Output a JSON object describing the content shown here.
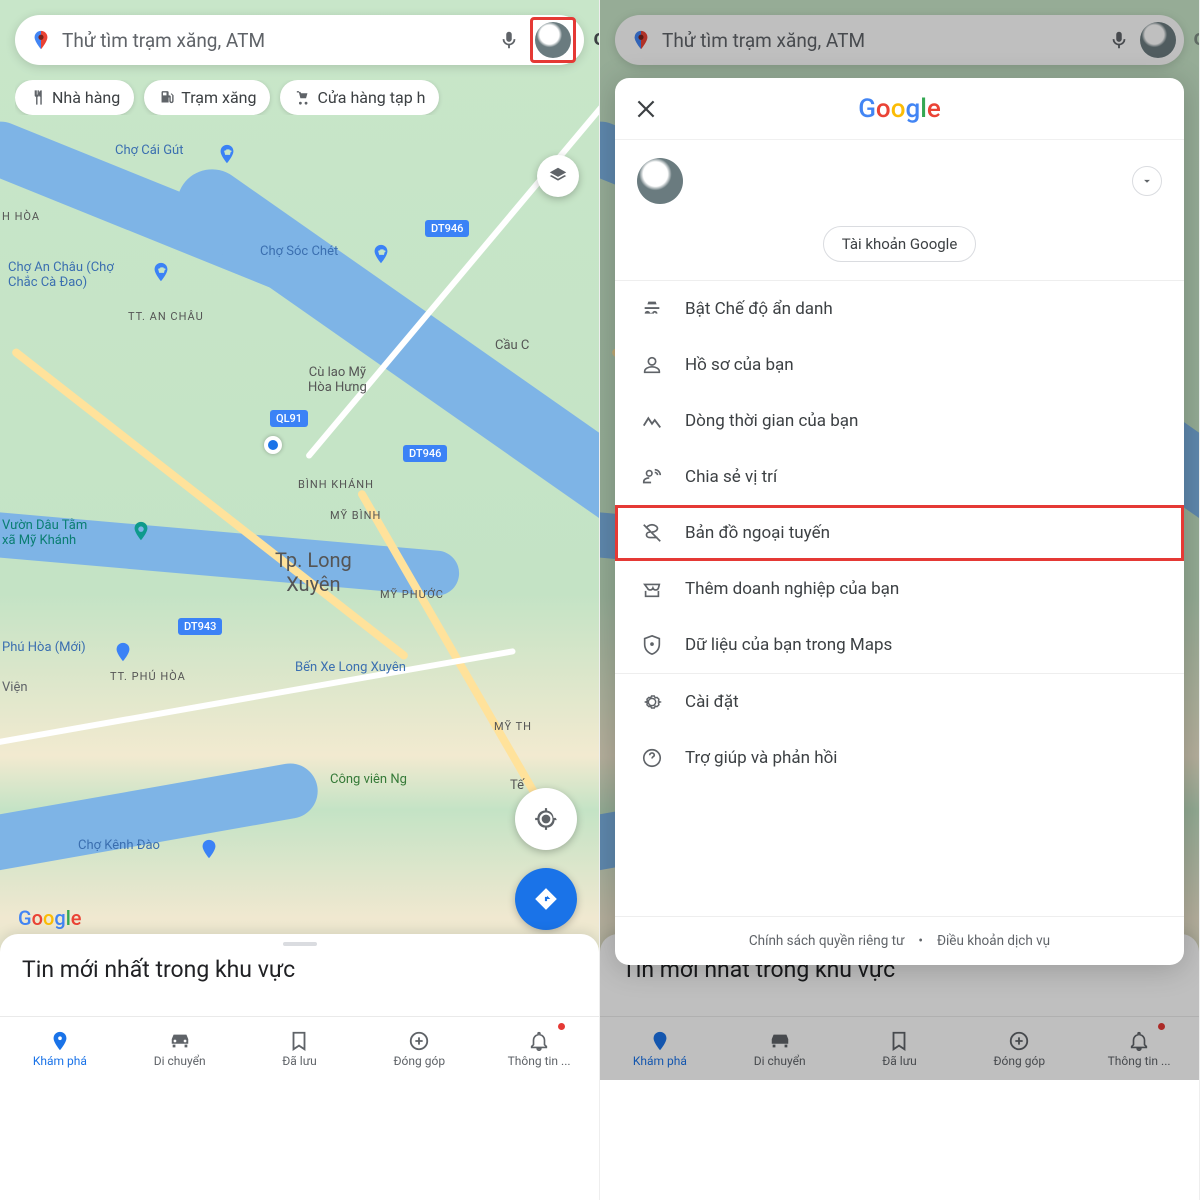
{
  "search": {
    "placeholder": "Thử tìm trạm xăng, ATM"
  },
  "chips": [
    "Nhà hàng",
    "Trạm xăng",
    "Cửa hàng tạp h"
  ],
  "map_labels": {
    "cho_cai_gut": "Chợ Cái Gút",
    "h_hoa": "H HÒA",
    "an_chau": "Chợ An Châu (Chợ\nChắc Cà Đao)",
    "tt_an_chau": "TT. AN CHÂU",
    "soc_chet": "Chợ Sóc Chét",
    "cu_lao": "Cù lao Mỹ\nHòa Hưng",
    "cau_ca": "Cầu C",
    "binh_khanh": "BÌNH KHÁNH",
    "my_binh": "MỸ BÌNH",
    "vuon_dau": "Vườn Dâu Tằm\nxã Mỹ Khánh",
    "long_xuyen": "Tp. Long\nXuyên",
    "my_phuoc": "MỸ PHƯỚC",
    "phu_hoa": "Phú Hòa (Mới)",
    "tt_phu_hoa": "TT. PHÚ HÒA",
    "ben_xe": "Bến Xe Long Xuyên",
    "cong_vien": "Công viên Ng",
    "kenh_dao": "Chợ Kênh Đào",
    "my_th": "MỸ TH",
    "vien": "Viện",
    "qlt91": "91",
    "te": "Tế"
  },
  "route_badges": [
    "DT946",
    "DT946",
    "QL91",
    "DT943",
    "DT946"
  ],
  "sheet_title": "Tin mới nhất trong khu vực",
  "nav": {
    "explore": "Khám phá",
    "go": "Di chuyển",
    "saved": "Đã lưu",
    "contribute": "Đóng góp",
    "updates": "Thông tin ..."
  },
  "menu": {
    "google_account": "Tài khoản Google",
    "items": [
      "Bật Chế độ ẩn danh",
      "Hồ sơ của bạn",
      "Dòng thời gian của bạn",
      "Chia sẻ vị trí",
      "Bản đồ ngoại tuyến",
      "Thêm doanh nghiệp của bạn",
      "Dữ liệu của bạn trong Maps",
      "Cài đặt",
      "Trợ giúp và phản hồi"
    ],
    "privacy": "Chính sách quyền riêng tư",
    "terms": "Điều khoản dịch vụ"
  },
  "brand": {
    "g": "G",
    "o1": "o",
    "o2": "o",
    "gl": "g",
    "l": "l",
    "e": "e"
  },
  "letters": {
    "c": "c"
  }
}
